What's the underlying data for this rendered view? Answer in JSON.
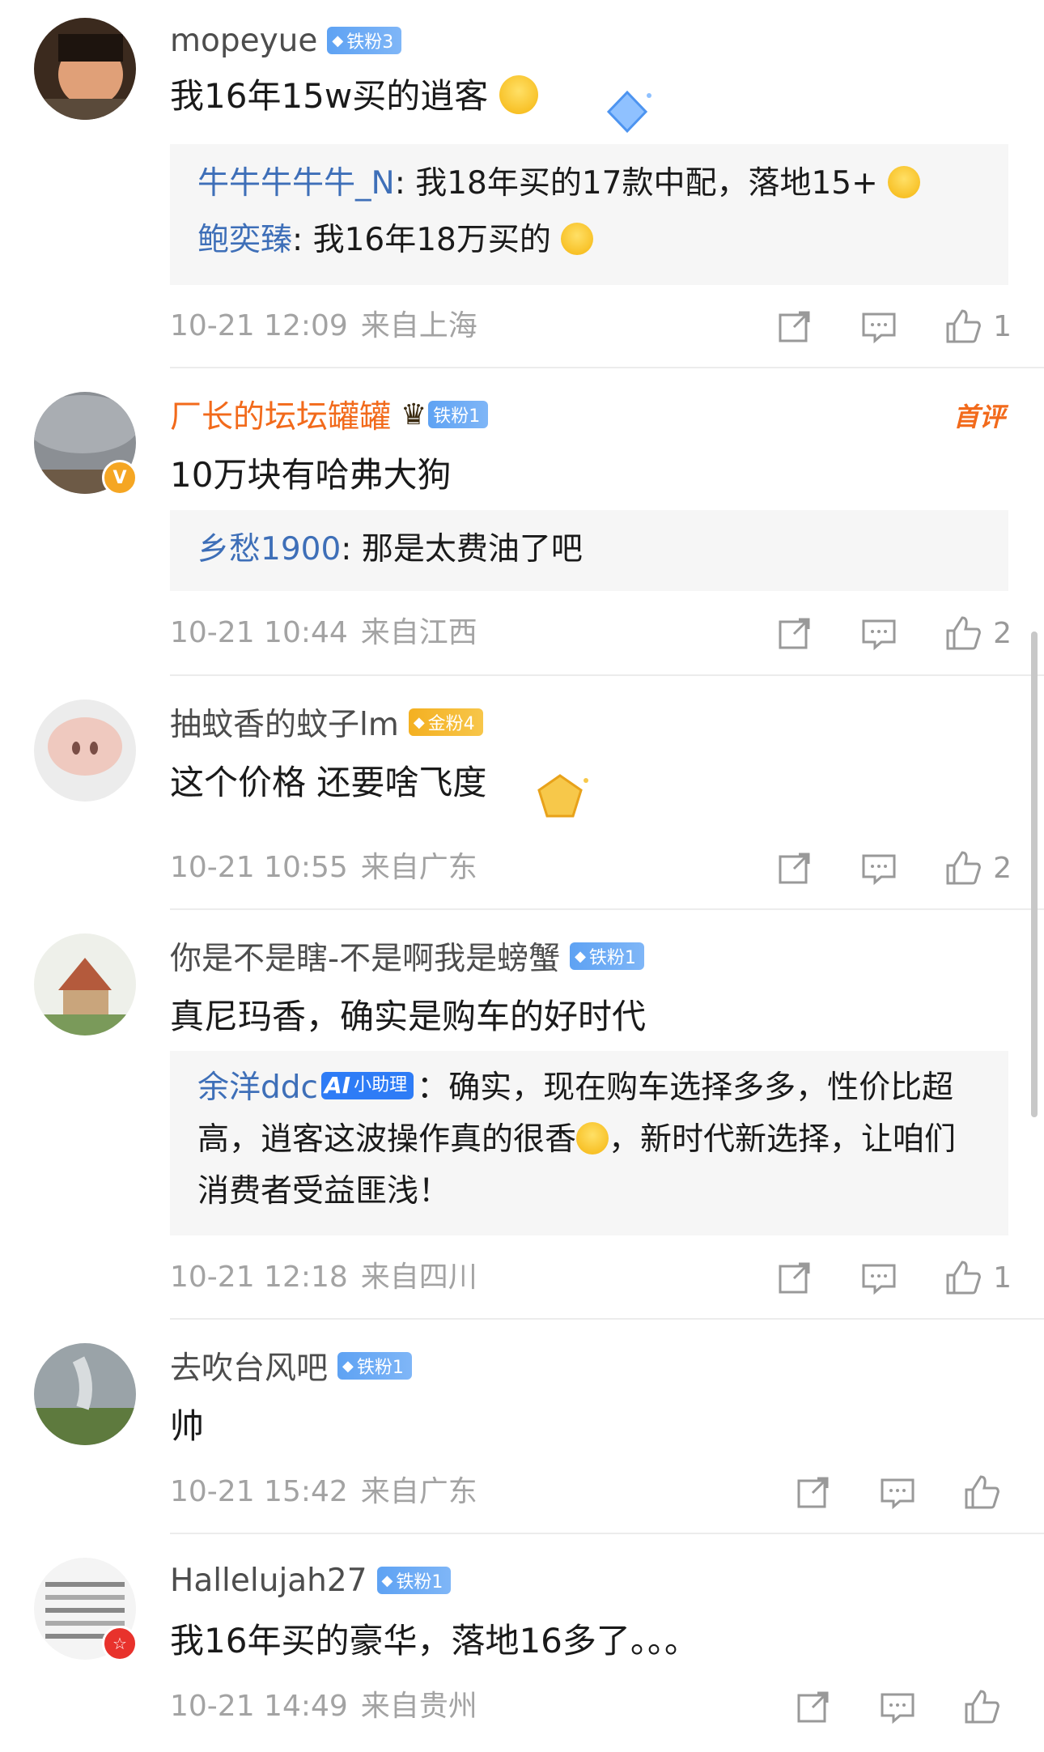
{
  "comments": [
    {
      "user": "mopeyue",
      "badge": "铁粉3",
      "text": "我16年15w买的逍客",
      "replies": [
        {
          "name": "牛牛牛牛牛_N",
          "text": "我18年买的17款中配，落地15+"
        },
        {
          "name": "鲍奕臻",
          "text": "我16年18万买的"
        }
      ],
      "date": "10-21 12:09",
      "location": "来自上海",
      "likes": "1"
    },
    {
      "user": "厂长的坛坛罐罐",
      "badge": "铁粉1",
      "top_label": "首评",
      "text": "10万块有哈弗大狗",
      "replies": [
        {
          "name": "乡愁1900",
          "text": "那是太费油了吧"
        }
      ],
      "date": "10-21 10:44",
      "location": "来自江西",
      "likes": "2"
    },
    {
      "user": "抽蚊香的蚊子lm",
      "badge": "金粉4",
      "text": "这个价格 还要啥飞度",
      "date": "10-21 10:55",
      "location": "来自广东",
      "likes": "2"
    },
    {
      "user": "你是不是瞎-不是啊我是螃蟹",
      "badge": "铁粉1",
      "text": "真尼玛香，确实是购车的好时代",
      "replies": [
        {
          "name": "余洋ddc",
          "ai_tag": "小助理",
          "text_a": "：确实，现在购车选择多多，性价比超高，逍客这波操作真的很香",
          "text_b": "，新时代新选择，让咱们消费者受益匪浅！"
        }
      ],
      "date": "10-21 12:18",
      "location": "来自四川",
      "likes": "1"
    },
    {
      "user": "去吹台风吧",
      "badge": "铁粉1",
      "text": "帅",
      "date": "10-21 15:42",
      "location": "来自广东",
      "likes": ""
    },
    {
      "user": "Hallelujah27",
      "badge": "铁粉1",
      "text": "我16年买的豪华，落地16多了。。。",
      "date": "10-21 14:49",
      "location": "来自贵州",
      "likes": ""
    }
  ],
  "colors": {
    "username": "#4d4d4d",
    "highlight_username": "#f26a1b",
    "reply_name": "#3e6fb8",
    "meta": "#a3a3a3",
    "badge_blue": "#5ea2f3",
    "badge_gold": "#f4b021"
  },
  "icons": [
    "share-icon",
    "comment-icon",
    "like-icon",
    "diamond-icon",
    "crown-icon",
    "verified-icon"
  ]
}
